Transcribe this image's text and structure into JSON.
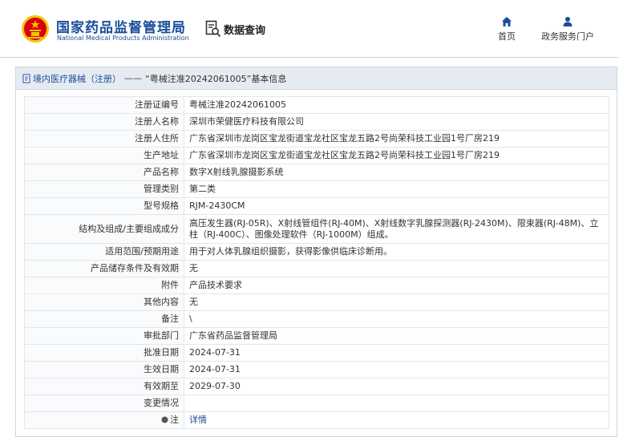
{
  "header": {
    "brand_cn": "国家药品监督管理局",
    "brand_en": "National Medical Products Administration",
    "data_query": "数据查询",
    "nav": [
      {
        "label": "首页",
        "icon": "home-icon"
      },
      {
        "label": "政务服务门户",
        "icon": "user-icon"
      }
    ]
  },
  "breadcrumb": {
    "category": "境内医疗器械（注册）",
    "separator": "——",
    "current": "“粤械注准20242061005”基本信息"
  },
  "fields": [
    {
      "label": "注册证编号",
      "value": "粤械注准20242061005"
    },
    {
      "label": "注册人名称",
      "value": "深圳市荣健医疗科技有限公司"
    },
    {
      "label": "注册人住所",
      "value": "广东省深圳市龙岗区宝龙街道宝龙社区宝龙五路2号尚荣科技工业园1号厂房219"
    },
    {
      "label": "生产地址",
      "value": "广东省深圳市龙岗区宝龙街道宝龙社区宝龙五路2号尚荣科技工业园1号厂房219"
    },
    {
      "label": "产品名称",
      "value": "数字X射线乳腺摄影系统"
    },
    {
      "label": "管理类别",
      "value": "第二类"
    },
    {
      "label": "型号规格",
      "value": "RJM-2430CM"
    },
    {
      "label": "结构及组成/主要组成成分",
      "value": "高压发生器(RJ-05R)、X射线管组件(RJ-40M)、X射线数字乳腺探测器(RJ-2430M)、限束器(RJ-48M)、立柱（RJ-400C）、图像处理软件（RJ-1000M）组成。"
    },
    {
      "label": "适用范围/预期用途",
      "value": "用于对人体乳腺组织摄影，获得影像供临床诊断用。"
    },
    {
      "label": "产品储存条件及有效期",
      "value": "无"
    },
    {
      "label": "附件",
      "value": "产品技术要求"
    },
    {
      "label": "其他内容",
      "value": "无"
    },
    {
      "label": "备注",
      "value": "\\"
    },
    {
      "label": "审批部门",
      "value": "广东省药品监督管理局"
    },
    {
      "label": "批准日期",
      "value": "2024-07-31"
    },
    {
      "label": "生效日期",
      "value": "2024-07-31"
    },
    {
      "label": "有效期至",
      "value": "2029-07-30"
    },
    {
      "label": "变更情况",
      "value": ""
    },
    {
      "label": "注",
      "value": "详情"
    }
  ],
  "colors": {
    "brand_blue": "#1a4d9c",
    "panel_header_bg": "#e6ebf2",
    "emblem_red": "#d7000f",
    "emblem_gold": "#f5c400"
  }
}
